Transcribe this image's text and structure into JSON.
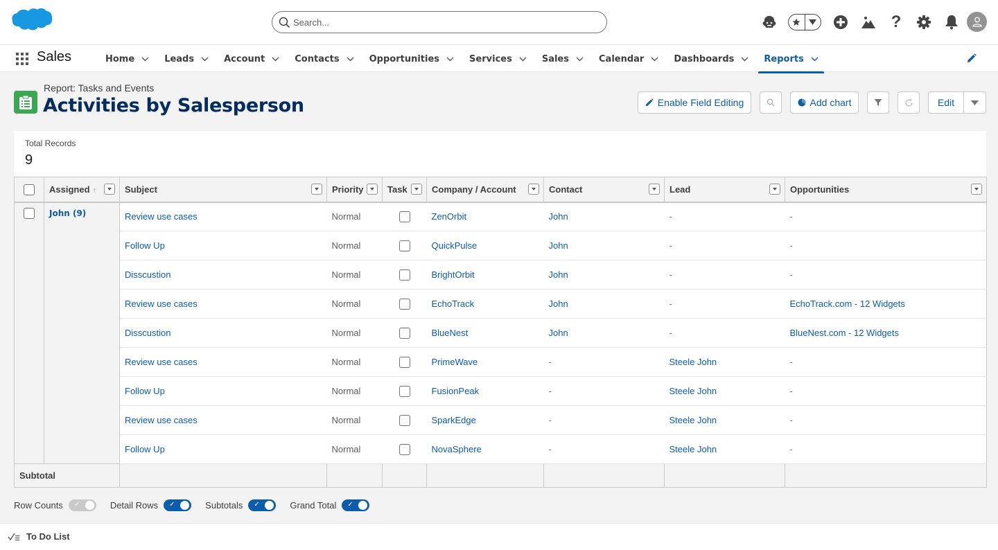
{
  "header": {
    "search_placeholder": "Search...",
    "icons": [
      "salesforce-logo",
      "agent-icon",
      "favorites-star-icon",
      "favorites-dropdown-icon",
      "global-create-icon",
      "trailhead-icon",
      "help-icon",
      "setup-gear-icon",
      "notifications-bell-icon",
      "user-avatar"
    ]
  },
  "nav": {
    "app_name": "Sales",
    "items": [
      {
        "label": "Home"
      },
      {
        "label": "Leads"
      },
      {
        "label": "Account"
      },
      {
        "label": "Contacts"
      },
      {
        "label": "Opportunities"
      },
      {
        "label": "Services"
      },
      {
        "label": "Sales"
      },
      {
        "label": "Calendar"
      },
      {
        "label": "Dashboards"
      },
      {
        "label": "Reports",
        "active": true
      }
    ]
  },
  "page": {
    "report_type": "Report: Tasks and Events",
    "title": "Activities by Salesperson",
    "buttons": {
      "enable_field_editing": "Enable Field Editing",
      "add_chart": "Add chart",
      "edit": "Edit"
    }
  },
  "summary": {
    "label": "Total Records",
    "value": "9"
  },
  "table": {
    "columns": [
      "Assigned",
      "Subject",
      "Priority",
      "Task",
      "Company / Account",
      "Contact",
      "Lead",
      "Opportunities"
    ],
    "sorted_column": "Assigned",
    "sort_direction": "ascending",
    "group": {
      "label": "John (9)"
    },
    "rows": [
      {
        "subject": "Review use cases",
        "priority": "Normal",
        "task": false,
        "company": "ZenOrbit",
        "contact": "John",
        "lead": "-",
        "opportunity": "-"
      },
      {
        "subject": "Follow Up",
        "priority": "Normal",
        "task": false,
        "company": "QuickPulse",
        "contact": "John",
        "lead": "-",
        "opportunity": "-"
      },
      {
        "subject": "Disscustion",
        "priority": "Normal",
        "task": false,
        "company": "BrightOrbit",
        "contact": "John",
        "lead": "-",
        "opportunity": "-"
      },
      {
        "subject": "Review use cases",
        "priority": "Normal",
        "task": false,
        "company": "EchoTrack",
        "contact": "John",
        "lead": "-",
        "opportunity": "EchoTrack.com - 12 Widgets"
      },
      {
        "subject": "Disscustion",
        "priority": "Normal",
        "task": false,
        "company": "BlueNest",
        "contact": "John",
        "lead": "-",
        "opportunity": "BlueNest.com - 12 Widgets"
      },
      {
        "subject": "Review use cases",
        "priority": "Normal",
        "task": false,
        "company": "PrimeWave",
        "contact": "-",
        "lead": "Steele John",
        "opportunity": "-"
      },
      {
        "subject": "Follow Up",
        "priority": "Normal",
        "task": false,
        "company": "FusionPeak",
        "contact": "-",
        "lead": "Steele John",
        "opportunity": "-"
      },
      {
        "subject": "Review use cases",
        "priority": "Normal",
        "task": false,
        "company": "SparkEdge",
        "contact": "-",
        "lead": "Steele John",
        "opportunity": "-"
      },
      {
        "subject": "Follow Up",
        "priority": "Normal",
        "task": false,
        "company": "NovaSphere",
        "contact": "-",
        "lead": "Steele John",
        "opportunity": "-"
      }
    ],
    "subtotal_label": "Subtotal"
  },
  "toggles": [
    {
      "label": "Row Counts",
      "on": false,
      "disabled": true
    },
    {
      "label": "Detail Rows",
      "on": true
    },
    {
      "label": "Subtotals",
      "on": true
    },
    {
      "label": "Grand Total",
      "on": true
    }
  ],
  "utility_bar": {
    "todo_label": "To Do List"
  },
  "colors": {
    "brand_blue": "#0b5cab",
    "title_navy": "#032d60",
    "report_icon_green": "#3ba755",
    "cloud_blue": "#1798e0"
  }
}
